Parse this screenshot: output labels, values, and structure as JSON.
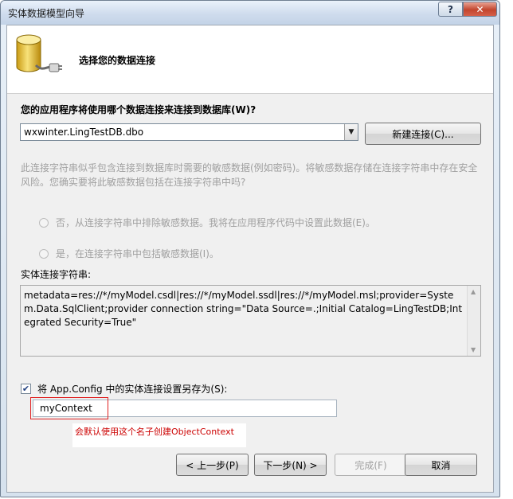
{
  "window": {
    "title": "实体数据模型向导",
    "help_label": "?",
    "close_label": "✕"
  },
  "header": {
    "title": "选择您的数据连接"
  },
  "connection": {
    "question": "您的应用程序将使用哪个数据连接来连接到数据库(W)?",
    "selected": "wxwinter.LingTestDB.dbo",
    "new_connection_label": "新建连接(C)..."
  },
  "sensitive": {
    "description": "此连接字符串似乎包含连接到数据库时需要的敏感数据(例如密码)。将敏感数据存储在连接字符串中存在安全风险。您确实要将此敏感数据包括在连接字符串中吗?",
    "option_no": "否，从连接字符串中排除敏感数据。我将在应用程序代码中设置此数据(E)。",
    "option_yes": "是，在连接字符串中包括敏感数据(I)。"
  },
  "entity_connection": {
    "label": "实体连接字符串:",
    "value": "metadata=res://*/myModel.csdl|res://*/myModel.ssdl|res://*/myModel.msl;provider=System.Data.SqlClient;provider connection string=\"Data Source=.;Initial Catalog=LingTestDB;Integrated Security=True\""
  },
  "save_config": {
    "label": "将 App.Config 中的实体连接设置另存为(S):",
    "checked": true,
    "check_mark": "✔",
    "name": "myContext"
  },
  "annotation": {
    "text": "会默认使用这个名子创建ObjectContext",
    "color": "#cc0000"
  },
  "footer": {
    "back_label": "< 上一步(P)",
    "next_label": "下一步(N) >",
    "finish_label": "完成(F)",
    "cancel_label": "取消"
  }
}
